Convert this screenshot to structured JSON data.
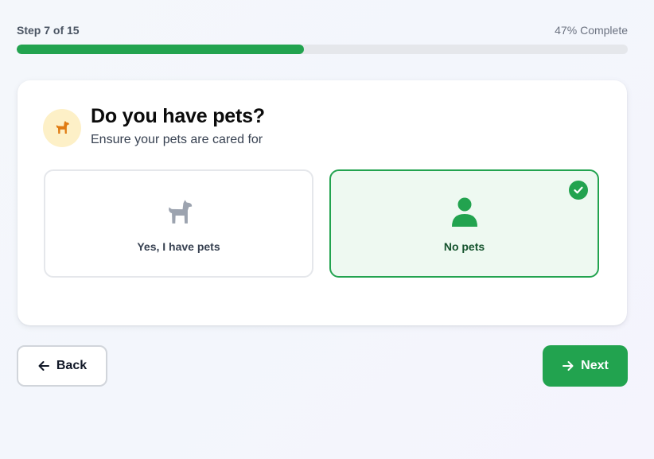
{
  "progress": {
    "step_text": "Step 7 of 15",
    "percent_text": "47% Complete",
    "fraction": 0.47,
    "fill_color": "#22a34f",
    "track_color": "#e5e7eb"
  },
  "question": {
    "icon": "dog-icon",
    "title": "Do you have pets?",
    "subtitle": "Ensure your pets are cared for"
  },
  "options": [
    {
      "label": "Yes, I have pets",
      "icon": "dog-icon",
      "selected": false
    },
    {
      "label": "No pets",
      "icon": "person-icon",
      "selected": true
    }
  ],
  "nav": {
    "back_label": "Back",
    "back_icon": "arrow-left-icon",
    "next_label": "Next",
    "next_icon": "arrow-right-icon"
  },
  "colors": {
    "accent": "#22a34f",
    "selected_bg": "#eef9f1",
    "question_icon_bg": "#fdf0c7",
    "question_icon_color": "#e07b12",
    "unselected_icon_color": "#9ca3af"
  }
}
